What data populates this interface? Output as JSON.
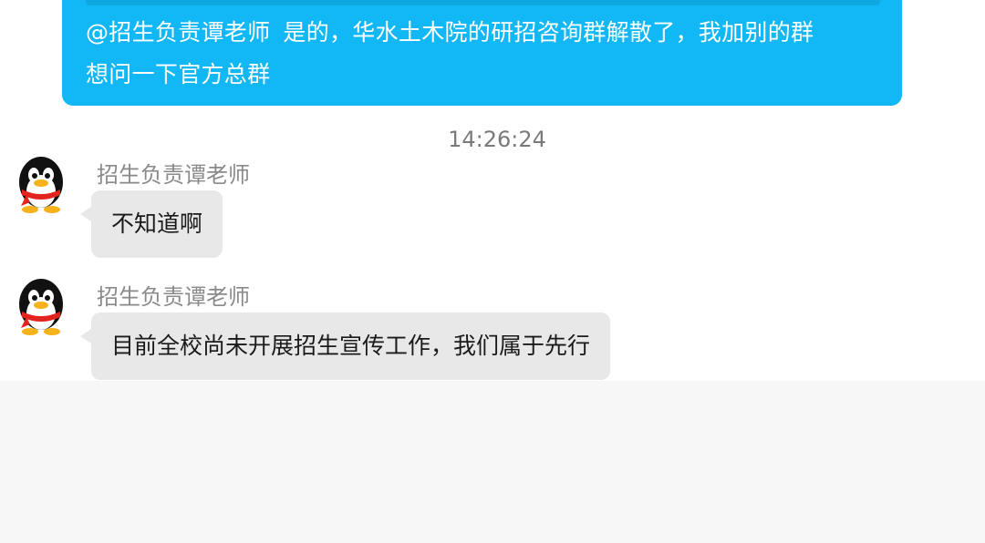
{
  "outgoing_message": {
    "mention": "@招生负责谭老师",
    "line1_rest": "是的，华水土木院的研招咨询群解散了，我加别的群",
    "line2": "想问一下官方总群"
  },
  "timestamp": "14:26:24",
  "messages": [
    {
      "sender": "招生负责谭老师",
      "avatar": "qq-penguin-avatar",
      "text": "不知道啊"
    },
    {
      "sender": "招生负责谭老师",
      "avatar": "qq-penguin-avatar",
      "text": "目前全校尚未开展招生宣传工作，我们属于先行"
    }
  ],
  "colors": {
    "outgoing_bubble": "#12b7f5",
    "incoming_bubble": "#e8e8e8",
    "input_area": "#f7f7f7"
  }
}
